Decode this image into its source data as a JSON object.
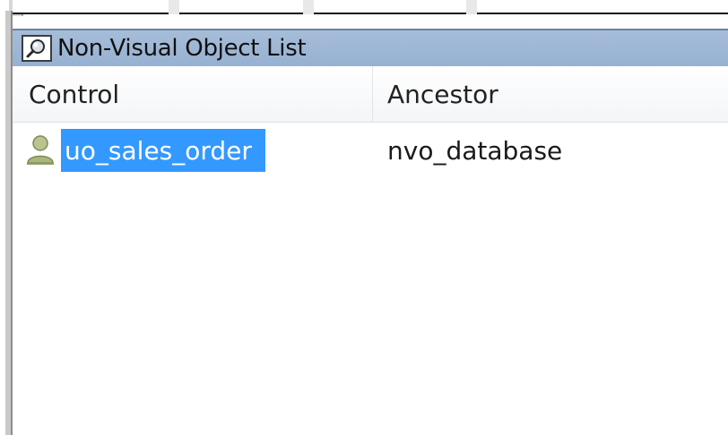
{
  "pane": {
    "title": "Non-Visual Object List",
    "title_icon": "magnifier-icon"
  },
  "list": {
    "columns": [
      "Control",
      "Ancestor"
    ],
    "rows": [
      {
        "control": "uo_sales_order",
        "ancestor": "nvo_database",
        "icon": "user-object-icon",
        "selected": true
      }
    ]
  },
  "colors": {
    "titlebar": "#a6bdd9",
    "selection": "#3399ff",
    "selection_text": "#ffffff"
  }
}
